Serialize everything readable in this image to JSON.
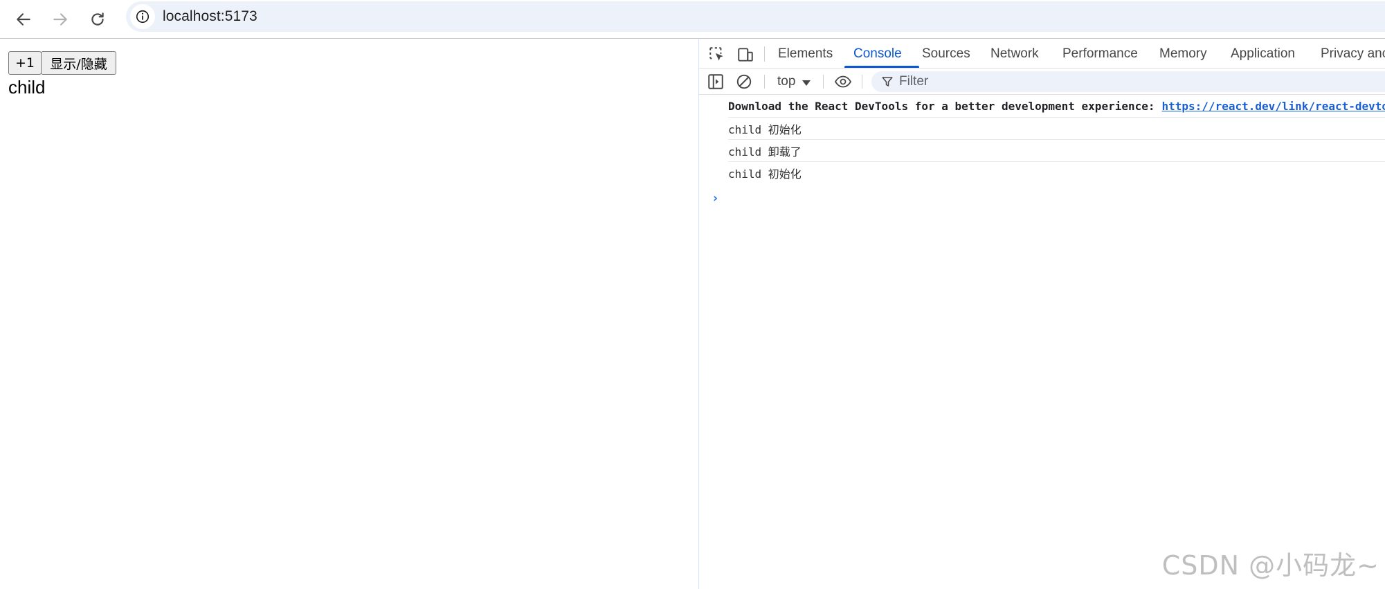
{
  "browser": {
    "back_icon": "arrow-left-icon",
    "forward_icon": "arrow-right-icon",
    "reload_icon": "reload-icon",
    "site_info_icon": "info-icon",
    "url": "localhost:5173"
  },
  "page": {
    "buttons": [
      {
        "label": "+1"
      },
      {
        "label": "显示/隐藏"
      }
    ],
    "text": "child"
  },
  "devtools": {
    "tabs": [
      {
        "label": "Elements",
        "active": false
      },
      {
        "label": "Console",
        "active": true
      },
      {
        "label": "Sources",
        "active": false
      },
      {
        "label": "Network",
        "active": false
      },
      {
        "label": "Performance",
        "active": false
      },
      {
        "label": "Memory",
        "active": false
      },
      {
        "label": "Application",
        "active": false
      },
      {
        "label": "Privacy anc",
        "active": false
      }
    ],
    "console_toolbar": {
      "context": "top",
      "filter_placeholder": "Filter"
    },
    "messages": [
      {
        "text": "Download the React DevTools for a better development experience:",
        "link": "https://react.dev/link/react-devtools",
        "bold": true
      },
      {
        "text": "child 初始化"
      },
      {
        "text": "child 卸载了"
      },
      {
        "text": "child 初始化"
      }
    ],
    "prompt": "›"
  },
  "watermark": "CSDN @小码龙~",
  "colors": {
    "accent": "#0b57d0",
    "address_bar_bg": "#edf1fa",
    "link": "#1a5fd1"
  }
}
